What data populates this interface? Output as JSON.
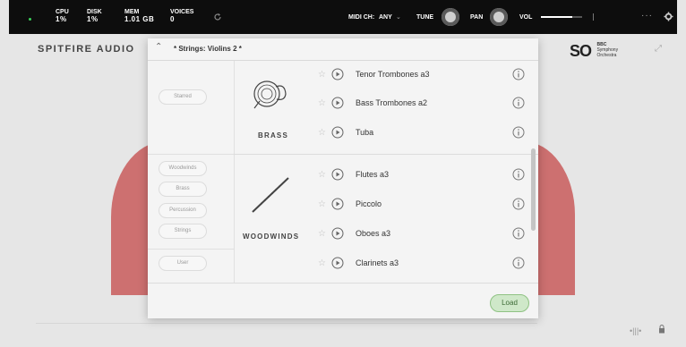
{
  "topbar": {
    "cpu_label": "CPU",
    "cpu_value": "1%",
    "disk_label": "DISK",
    "disk_value": "1%",
    "mem_label": "MEM",
    "mem_value": "1.01 GB",
    "voices_label": "VOICES",
    "voices_value": "0",
    "midi_label": "MIDI CH:",
    "midi_value": "ANY",
    "tune_label": "TUNE",
    "pan_label": "PAN",
    "vol_label": "VOL",
    "volume_level": 0.75,
    "more_label": "···",
    "status_color": "#3ad05a"
  },
  "header": {
    "brand": "SPITFIRE AUDIO",
    "logo_so": "SO",
    "logo_bbc": "BBC",
    "logo_line1": "Symphony",
    "logo_line2": "Orchestra"
  },
  "browser": {
    "preset_name": "* Strings: Violins 2 *",
    "sidebar": {
      "starred": "Starred",
      "categories": [
        "Woodwinds",
        "Brass",
        "Percussion",
        "Strings"
      ],
      "user": "User"
    },
    "sections": [
      {
        "family": "BRASS",
        "items": [
          "Tenor Trombones a3",
          "Bass Trombones a2",
          "Tuba"
        ]
      },
      {
        "family": "WOODWINDS",
        "items": [
          "Flutes a3",
          "Piccolo",
          "Oboes a3",
          "Clarinets a3"
        ]
      }
    ],
    "load_label": "Load"
  },
  "colors": {
    "accent_red": "#cd7070",
    "load_green": "#cfe8c9"
  }
}
